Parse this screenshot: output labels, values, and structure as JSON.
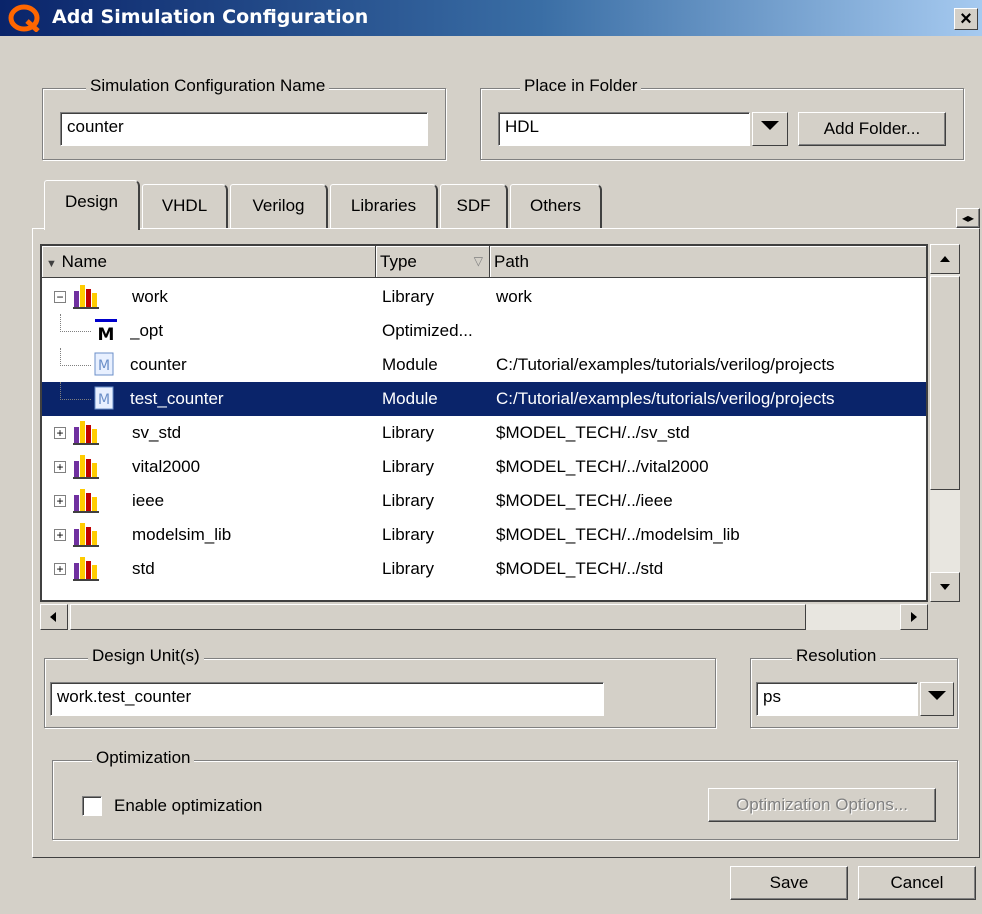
{
  "window": {
    "title": "Add Simulation Configuration",
    "close_glyph": "×"
  },
  "config_name": {
    "legend": "Simulation Configuration Name",
    "value": "counter"
  },
  "folder": {
    "legend": "Place in Folder",
    "value": "HDL",
    "add_button": "Add Folder..."
  },
  "tabs": [
    "Design",
    "VHDL",
    "Verilog",
    "Libraries",
    "SDF",
    "Others"
  ],
  "tab_scroll_glyph": "◂▸",
  "tree": {
    "columns": [
      "Name",
      "Type",
      "Path"
    ],
    "rows": [
      {
        "name": "work",
        "type": "Library",
        "path": "work",
        "icon": "library-icon",
        "expander": "−"
      },
      {
        "name": "_opt",
        "type": "Optimized...",
        "path": "",
        "icon": "optimized-module-icon"
      },
      {
        "name": "counter",
        "type": "Module",
        "path": "C:/Tutorial/examples/tutorials/verilog/projects",
        "icon": "module-icon"
      },
      {
        "name": "test_counter",
        "type": "Module",
        "path": "C:/Tutorial/examples/tutorials/verilog/projects",
        "icon": "module-icon",
        "selected": true
      },
      {
        "name": "sv_std",
        "type": "Library",
        "path": "$MODEL_TECH/../sv_std",
        "icon": "library-icon",
        "expander": "+"
      },
      {
        "name": "vital2000",
        "type": "Library",
        "path": "$MODEL_TECH/../vital2000",
        "icon": "library-icon",
        "expander": "+"
      },
      {
        "name": "ieee",
        "type": "Library",
        "path": "$MODEL_TECH/../ieee",
        "icon": "library-icon",
        "expander": "+"
      },
      {
        "name": "modelsim_lib",
        "type": "Library",
        "path": "$MODEL_TECH/../modelsim_lib",
        "icon": "library-icon",
        "expander": "+"
      },
      {
        "name": "std",
        "type": "Library",
        "path": "$MODEL_TECH/../std",
        "icon": "library-icon",
        "expander": "+"
      }
    ]
  },
  "design_units": {
    "legend": "Design Unit(s)",
    "value": "work.test_counter"
  },
  "resolution": {
    "legend": "Resolution",
    "value": "ps"
  },
  "optimization": {
    "legend": "Optimization",
    "checkbox_label": "Enable optimization",
    "checked": false,
    "options_button": "Optimization Options..."
  },
  "footer": {
    "save": "Save",
    "cancel": "Cancel"
  },
  "colors": {
    "selection": "#0a246a",
    "title_start": "#0a246a",
    "title_end": "#a6caf0",
    "library_icon": "#ffcc00"
  }
}
